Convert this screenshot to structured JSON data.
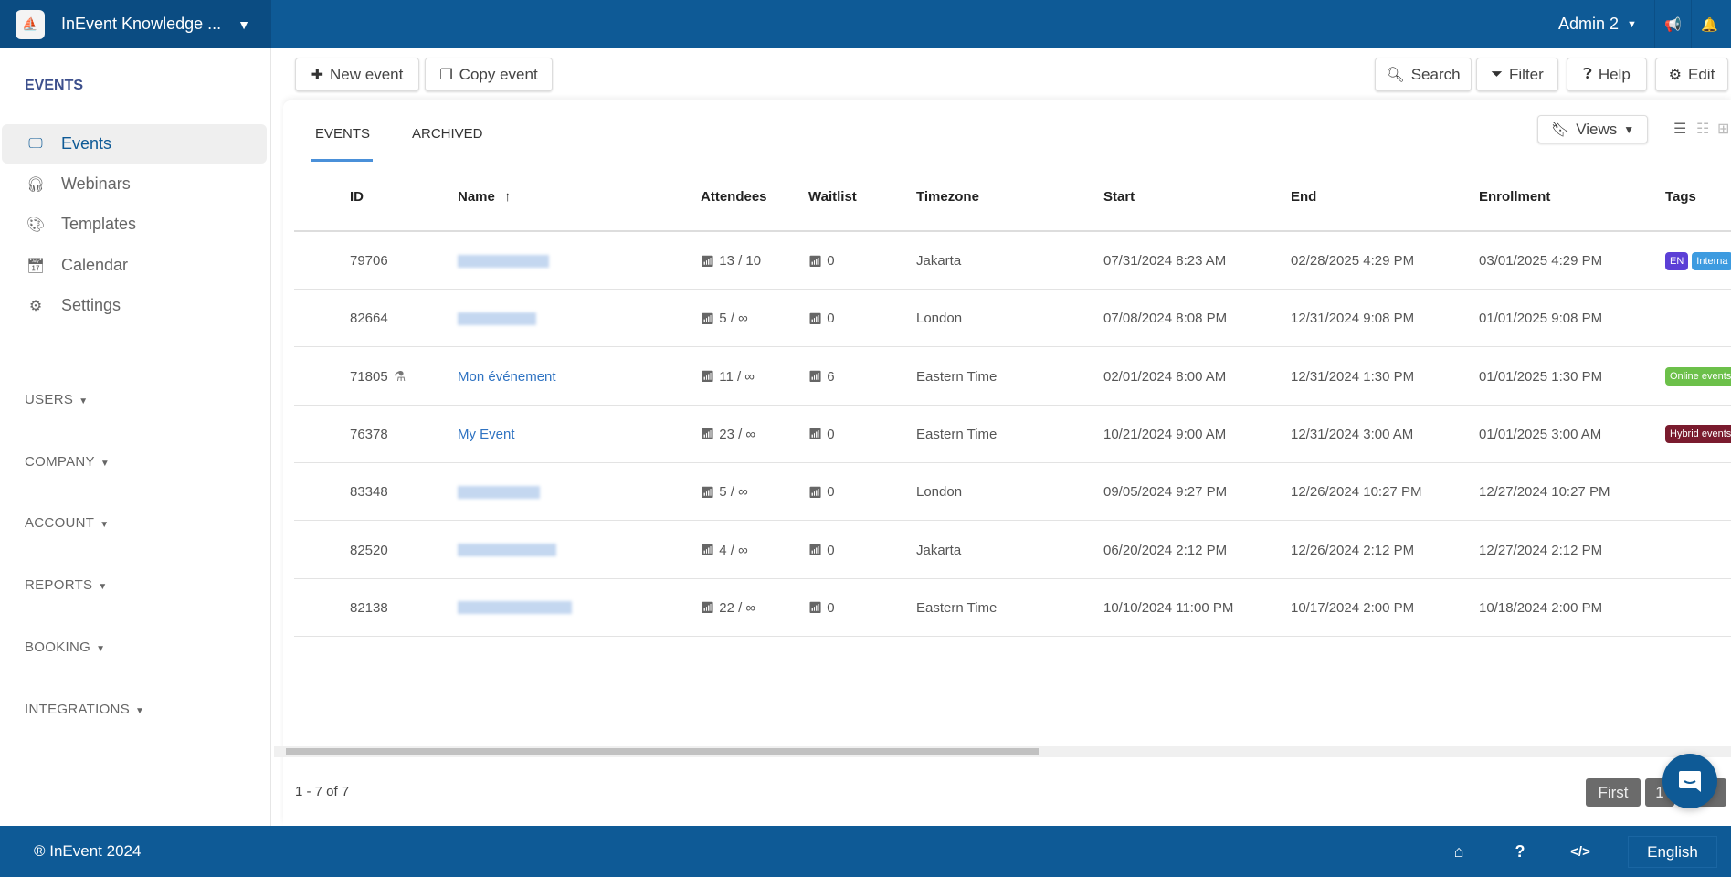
{
  "header": {
    "org_name": "InEvent Knowledge ...",
    "user": "Admin 2",
    "icons": [
      "megaphone-icon",
      "bell-icon"
    ],
    "color": "#0e5a96"
  },
  "sidebar": {
    "title": "EVENTS",
    "items": [
      {
        "label": "Events",
        "icon": "presentation-icon",
        "active": true
      },
      {
        "label": "Webinars",
        "icon": "headset-icon"
      },
      {
        "label": "Templates",
        "icon": "palette-icon"
      },
      {
        "label": "Calendar",
        "icon": "calendar-icon"
      },
      {
        "label": "Settings",
        "icon": "gear-icon"
      }
    ],
    "sections": [
      "USERS",
      "COMPANY",
      "ACCOUNT",
      "REPORTS",
      "BOOKING",
      "INTEGRATIONS"
    ]
  },
  "toolbar": {
    "new_event": "New event",
    "copy_event": "Copy event",
    "search": "Search",
    "filter": "Filter",
    "help": "Help",
    "edit": "Edit"
  },
  "tabs": [
    {
      "label": "EVENTS",
      "active": true
    },
    {
      "label": "ARCHIVED"
    }
  ],
  "views_label": "Views",
  "table": {
    "columns": [
      "ID",
      "Name",
      "Attendees",
      "Waitlist",
      "Timezone",
      "Start",
      "End",
      "Enrollment",
      "Tags"
    ],
    "sort_indicator": "↑",
    "rows": [
      {
        "id": "79706",
        "name": null,
        "attendees": "13 / 10",
        "waitlist": "0",
        "timezone": "Jakarta",
        "start": "07/31/2024 8:23 AM",
        "end": "02/28/2025 4:29 PM",
        "enrollment": "03/01/2025 4:29 PM",
        "tags": [
          {
            "label": "EN",
            "color": "#5b3fd6"
          },
          {
            "label": "Interna",
            "color": "#3d9be0"
          }
        ]
      },
      {
        "id": "82664",
        "name": null,
        "attendees": "5 / ∞",
        "waitlist": "0",
        "timezone": "London",
        "start": "07/08/2024 8:08 PM",
        "end": "12/31/2024 9:08 PM",
        "enrollment": "01/01/2025 9:08 PM",
        "tags": []
      },
      {
        "id": "71805",
        "test_icon": true,
        "name": "Mon événement",
        "attendees": "11 / ∞",
        "waitlist": "6",
        "timezone": "Eastern Time",
        "start": "02/01/2024 8:00 AM",
        "end": "12/31/2024 1:30 PM",
        "enrollment": "01/01/2025 1:30 PM",
        "tags": [
          {
            "label": "Online events",
            "color": "#6cc04a"
          }
        ]
      },
      {
        "id": "76378",
        "name": "My Event",
        "attendees": "23 / ∞",
        "waitlist": "0",
        "timezone": "Eastern Time",
        "start": "10/21/2024 9:00 AM",
        "end": "12/31/2024 3:00 AM",
        "enrollment": "01/01/2025 3:00 AM",
        "tags": [
          {
            "label": "Hybrid events",
            "color": "#7a1b2e"
          }
        ]
      },
      {
        "id": "83348",
        "name": null,
        "attendees": "5 / ∞",
        "waitlist": "0",
        "timezone": "London",
        "start": "09/05/2024 9:27 PM",
        "end": "12/26/2024 10:27 PM",
        "enrollment": "12/27/2024 10:27 PM",
        "tags": []
      },
      {
        "id": "82520",
        "name": null,
        "attendees": "4 / ∞",
        "waitlist": "0",
        "timezone": "Jakarta",
        "start": "06/20/2024 2:12 PM",
        "end": "12/26/2024 2:12 PM",
        "enrollment": "12/27/2024 2:12 PM",
        "tags": []
      },
      {
        "id": "82138",
        "name": null,
        "attendees": "22 / ∞",
        "waitlist": "0",
        "timezone": "Eastern Time",
        "start": "10/10/2024 11:00 PM",
        "end": "10/17/2024 2:00 PM",
        "enrollment": "10/18/2024 2:00 PM",
        "tags": []
      }
    ]
  },
  "pagination": {
    "summary": "1 - 7 of 7",
    "first": "First",
    "page": "1"
  },
  "footer": {
    "copyright": "® InEvent 2024",
    "language": "English",
    "icons": [
      "home-icon",
      "question-icon",
      "code-icon"
    ]
  }
}
